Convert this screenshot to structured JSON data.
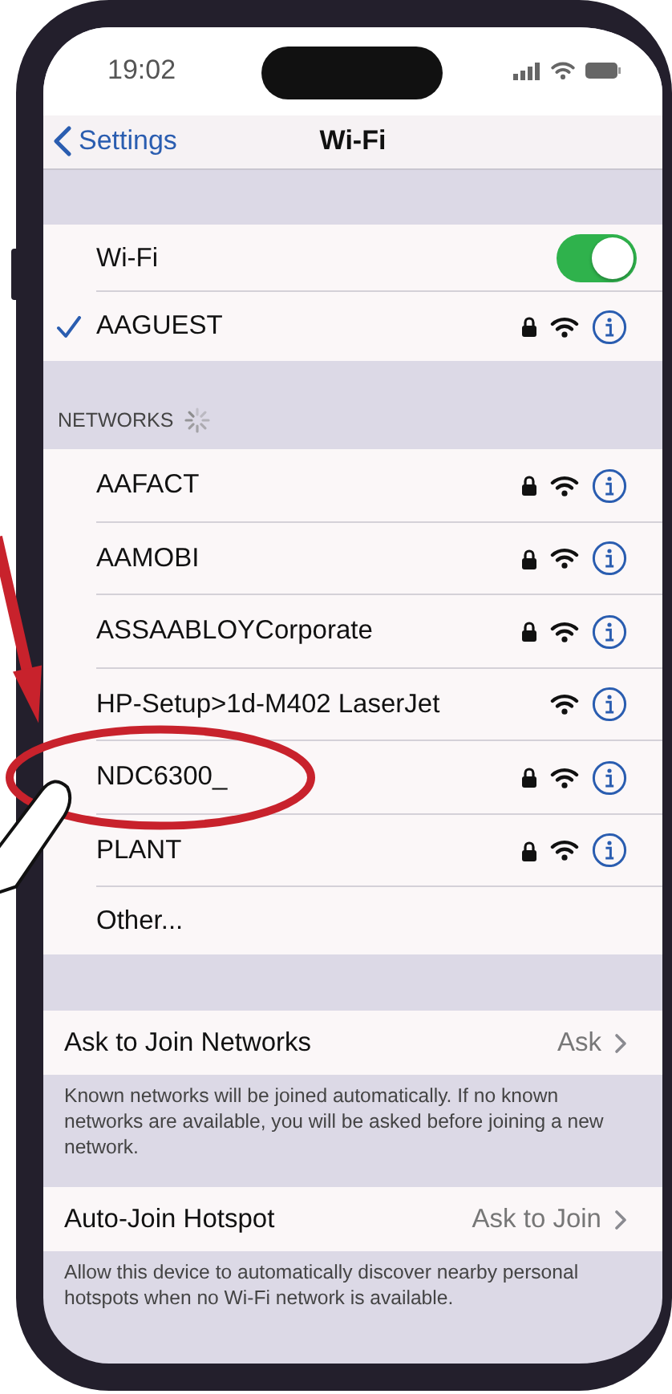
{
  "status_bar": {
    "time": "19:02"
  },
  "nav": {
    "back": "Settings",
    "title": "Wi-Fi"
  },
  "wifi": {
    "label": "Wi-Fi",
    "on": true
  },
  "current_network": {
    "name": "AAGUEST",
    "connected": true,
    "locked": true
  },
  "networks_header": {
    "title": "NETWORKS",
    "searching": true
  },
  "networks": [
    {
      "name": "AAFACT",
      "locked": true,
      "highlighted": false
    },
    {
      "name": "AAMOBI",
      "locked": true,
      "highlighted": false
    },
    {
      "name": "ASSAABLOYCorporate",
      "locked": true,
      "highlighted": false
    },
    {
      "name": "HP-Setup>1d-M402 LaserJet",
      "locked": false,
      "highlighted": false
    },
    {
      "name": "NDC6300_",
      "locked": true,
      "highlighted": true
    },
    {
      "name": "PLANT",
      "locked": true,
      "highlighted": false
    }
  ],
  "other": {
    "label": "Other..."
  },
  "settings": [
    {
      "label": "Ask to Join Networks",
      "value": "Ask",
      "footer": "Known networks will be joined automatically. If no known networks are available, you will be asked before joining a new network."
    },
    {
      "label": "Auto-Join Hotspot",
      "value": "Ask to Join",
      "footer": "Allow this device to automatically discover nearby personal hotspots when no Wi-Fi network is available."
    }
  ]
}
